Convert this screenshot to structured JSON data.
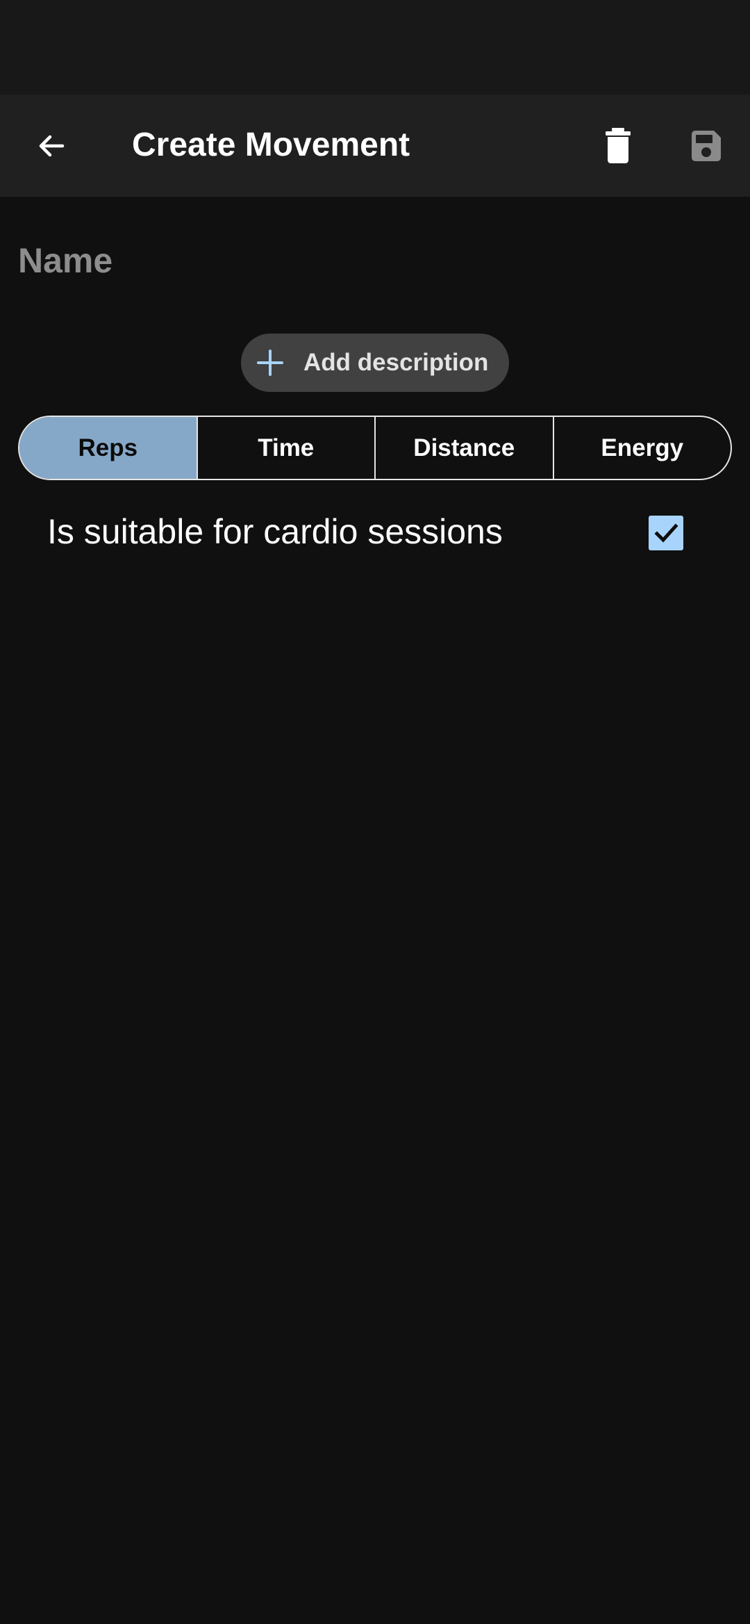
{
  "app_bar": {
    "title": "Create Movement",
    "back_icon": "arrow-back-icon",
    "delete_icon": "trash-icon",
    "save_icon": "floppy-disk-icon"
  },
  "form": {
    "name_value": "",
    "name_placeholder": "Name",
    "add_description_label": "Add description",
    "add_description_icon": "plus-icon"
  },
  "dimension_selector": {
    "options": [
      "Reps",
      "Time",
      "Distance",
      "Energy"
    ],
    "selected": "Reps"
  },
  "cardio": {
    "label": "Is suitable for cardio sessions",
    "checked": true
  },
  "colors": {
    "background": "#101010",
    "app_bar": "#202020",
    "selected_segment": "#86a8c8",
    "checkbox_fill": "#a8d4fb",
    "chip_background": "#414141",
    "plus_icon": "#a8d4fb",
    "save_icon_disabled": "#8a8a8a"
  }
}
